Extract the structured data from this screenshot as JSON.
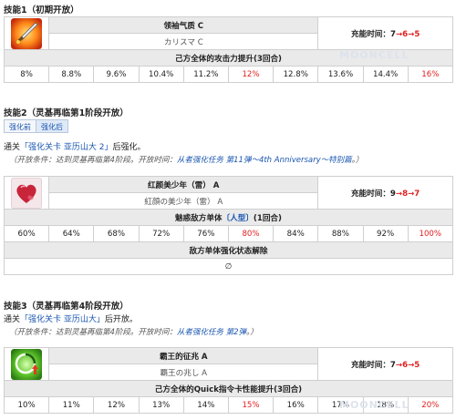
{
  "skill1": {
    "heading": "技能1（初期开放）",
    "name": "领袖气质 C",
    "jp_name": "カリスマ C",
    "cd_label": "充能时间：",
    "cd_values": [
      "7",
      "6",
      "5"
    ],
    "effect": "己方全体的攻击力提升(3回合)",
    "values": [
      "8%",
      "8.8%",
      "9.6%",
      "10.4%",
      "11.2%",
      "12%",
      "12.8%",
      "13.6%",
      "14.4%",
      "16%"
    ]
  },
  "skill2": {
    "heading": "技能2（灵基再临第1阶段开放）",
    "tab_before": "强化前",
    "tab_after": "强化后",
    "unlock_prefix": "通关",
    "unlock_quest": "「强化关卡 亚历山大 2」",
    "unlock_suffix": "后强化。",
    "cond_prefix": "（开放条件：达到灵基再临第4阶段。开放时间：",
    "cond_event": "从者强化任务 第11弹～4th Anniversary～特别篇",
    "cond_suffix": "。）",
    "name": "红颜美少年（雷） A",
    "jp_name": "紅顔の美少年（雷） A",
    "cd_label": "充能时间：",
    "cd_values": [
      "9",
      "8",
      "7"
    ],
    "effect_prefix": "魅惑敌方单体",
    "effect_trait": "〔人型〕",
    "effect_suffix": "(1回合)",
    "values": [
      "60%",
      "64%",
      "68%",
      "72%",
      "76%",
      "80%",
      "84%",
      "88%",
      "92%",
      "100%"
    ],
    "effect2": "敌方单体强化状态解除",
    "effect2_value": "∅"
  },
  "skill3": {
    "heading": "技能3（灵基再临第4阶段开放）",
    "unlock_prefix": "通关",
    "unlock_quest": "「强化关卡 亚历山大」",
    "unlock_suffix": "后开放。",
    "cond_prefix": "（开放条件：达到灵基再临第4阶段。开放时间：",
    "cond_event": "从者强化任务 第2弹",
    "cond_suffix": "。）",
    "name": "霸王的征兆 A",
    "jp_name": "覇王の兆し A",
    "cd_label": "充能时间：",
    "cd_values": [
      "7",
      "6",
      "5"
    ],
    "effect": "己方全体的Quick指令卡性能提升(3回合)",
    "values": [
      "10%",
      "11%",
      "12%",
      "13%",
      "14%",
      "15%",
      "16%",
      "17%",
      "18%",
      "20%"
    ]
  },
  "watermark": "MOONCELL",
  "colors": {
    "highlight": "#e02020",
    "link": "#1a56b0",
    "header_bg": "#eaeaea"
  }
}
